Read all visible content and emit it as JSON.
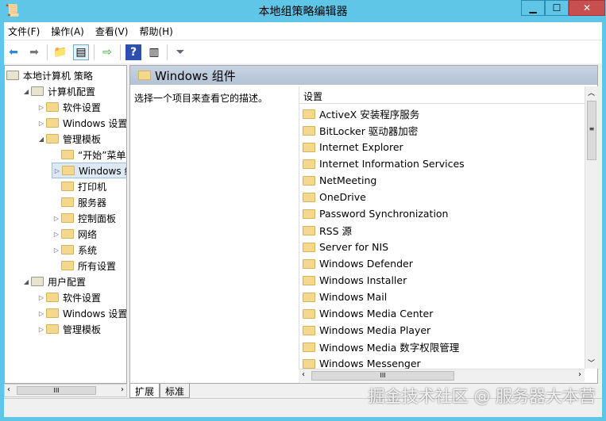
{
  "window": {
    "title": "本地组策略编辑器"
  },
  "menu": [
    "文件(F)",
    "操作(A)",
    "查看(V)",
    "帮助(H)"
  ],
  "tree": [
    {
      "label": "本地计算机 策略",
      "level": 0,
      "arrow": ""
    },
    {
      "label": "计算机配置",
      "level": 1,
      "arrow": "◢"
    },
    {
      "label": "软件设置",
      "level": 2,
      "arrow": "▷"
    },
    {
      "label": "Windows 设置",
      "level": 2,
      "arrow": "▷"
    },
    {
      "label": "管理模板",
      "level": 2,
      "arrow": "◢"
    },
    {
      "label": "“开始”菜单和任务栏",
      "level": 3,
      "arrow": ""
    },
    {
      "label": "Windows 组件",
      "level": 3,
      "arrow": "▷",
      "selected": true
    },
    {
      "label": "打印机",
      "level": 3,
      "arrow": ""
    },
    {
      "label": "服务器",
      "level": 3,
      "arrow": ""
    },
    {
      "label": "控制面板",
      "level": 3,
      "arrow": "▷"
    },
    {
      "label": "网络",
      "level": 3,
      "arrow": "▷"
    },
    {
      "label": "系统",
      "level": 3,
      "arrow": "▷"
    },
    {
      "label": "所有设置",
      "level": 3,
      "arrow": ""
    },
    {
      "label": "用户配置",
      "level": 1,
      "arrow": "◢"
    },
    {
      "label": "软件设置",
      "level": 2,
      "arrow": "▷"
    },
    {
      "label": "Windows 设置",
      "level": 2,
      "arrow": "▷"
    },
    {
      "label": "管理模板",
      "level": 2,
      "arrow": "▷"
    }
  ],
  "pane": {
    "title": "Windows 组件",
    "description": "选择一个项目来查看它的描述。",
    "column": "设置"
  },
  "items": [
    "ActiveX 安装程序服务",
    "BitLocker 驱动器加密",
    "Internet Explorer",
    "Internet Information Services",
    "NetMeeting",
    "OneDrive",
    "Password Synchronization",
    "RSS 源",
    "Server for NIS",
    "Windows Defender",
    "Windows Installer",
    "Windows Mail",
    "Windows Media Center",
    "Windows Media Player",
    "Windows Media 数字权限管理",
    "Windows Messenger"
  ],
  "tabs": [
    "扩展",
    "标准"
  ],
  "watermark": "掘金技术社区 @ 服务器大本营"
}
